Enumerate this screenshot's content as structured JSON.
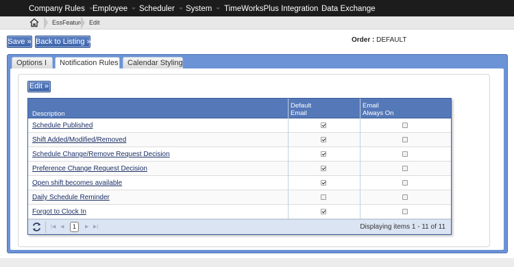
{
  "nav": {
    "items": [
      {
        "label": "Company Rules"
      },
      {
        "label": "Employee"
      },
      {
        "label": "Scheduler"
      },
      {
        "label": "System"
      },
      {
        "label": "TimeWorksPlus Integration"
      },
      {
        "label": "Data Exchange"
      }
    ]
  },
  "breadcrumb": {
    "home_icon": "home-icon",
    "items": [
      {
        "label": "EssFeature"
      },
      {
        "label": "Edit"
      }
    ]
  },
  "toolbar": {
    "save_label": "Save »",
    "back_label": "Back to Listing »",
    "order_label": "Order :",
    "order_value": "DEFAULT"
  },
  "tabs": [
    {
      "label": "Options I",
      "active": false
    },
    {
      "label": "Notification Rules",
      "active": true
    },
    {
      "label": "Calendar Styling",
      "active": false
    }
  ],
  "panel": {
    "edit_label": "Edit »"
  },
  "grid": {
    "columns": {
      "description": "Description",
      "default_email_line1": "Default",
      "default_email_line2": "Email",
      "email_always_on_line1": "Email",
      "email_always_on_line2": "Always On"
    },
    "rows": [
      {
        "description": "Schedule Published",
        "default_email": true,
        "email_always_on": false
      },
      {
        "description": "Shift Added/Modified/Removed",
        "default_email": true,
        "email_always_on": false
      },
      {
        "description": "Schedule Change/Remove Request Decision",
        "default_email": true,
        "email_always_on": false
      },
      {
        "description": "Preference Change Request Decision",
        "default_email": true,
        "email_always_on": false
      },
      {
        "description": "Open shift becomes available",
        "default_email": true,
        "email_always_on": false
      },
      {
        "description": "Daily Schedule Reminder",
        "default_email": false,
        "email_always_on": false
      },
      {
        "description": "Forgot to Clock In",
        "default_email": true,
        "email_always_on": false
      }
    ],
    "pager": {
      "current_page": "1",
      "info": "Displaying items 1 - 11 of 11"
    }
  },
  "colors": {
    "nav_bg": "#1c1c1c",
    "accent": "#3c63a8",
    "panel": "#6b93d6",
    "grid_header": "#5478b8"
  }
}
